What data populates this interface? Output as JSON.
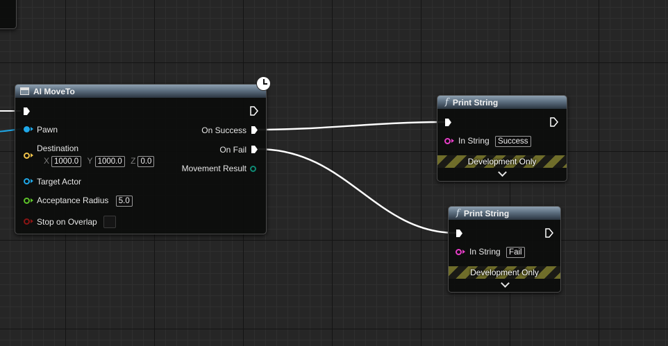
{
  "graph": {
    "ai_move_to": {
      "title": "AI MoveTo",
      "inputs": {
        "pawn": "Pawn",
        "destination": "Destination",
        "dest_x_label": "X",
        "dest_x": "1000.0",
        "dest_y_label": "Y",
        "dest_y": "1000.0",
        "dest_z_label": "Z",
        "dest_z": "0.0",
        "target_actor": "Target Actor",
        "acceptance_radius": "Acceptance Radius",
        "acceptance_radius_value": "5.0",
        "stop_on_overlap": "Stop on Overlap"
      },
      "outputs": {
        "on_success": "On Success",
        "on_fail": "On Fail",
        "movement_result": "Movement Result"
      }
    },
    "print_success": {
      "title": "Print String",
      "in_string_label": "In String",
      "in_string_value": "Success",
      "dev_only": "Development Only"
    },
    "print_fail": {
      "title": "Print String",
      "in_string_label": "In String",
      "in_string_value": "Fail",
      "dev_only": "Development Only"
    }
  },
  "icons": {
    "function": "f",
    "latent": "clock-icon",
    "expand": "chevron-down-icon"
  },
  "colors": {
    "background": "#262626",
    "exec_wire": "#ffffff",
    "object_pin": "#1fa8e8",
    "vector_pin": "#f2c34a",
    "float_pin": "#5ec32a",
    "bool_pin": "#8a1414",
    "string_pin": "#e83ec8",
    "enum_pin": "#0e8a74",
    "dev_stripe": "#6f6d2a"
  }
}
